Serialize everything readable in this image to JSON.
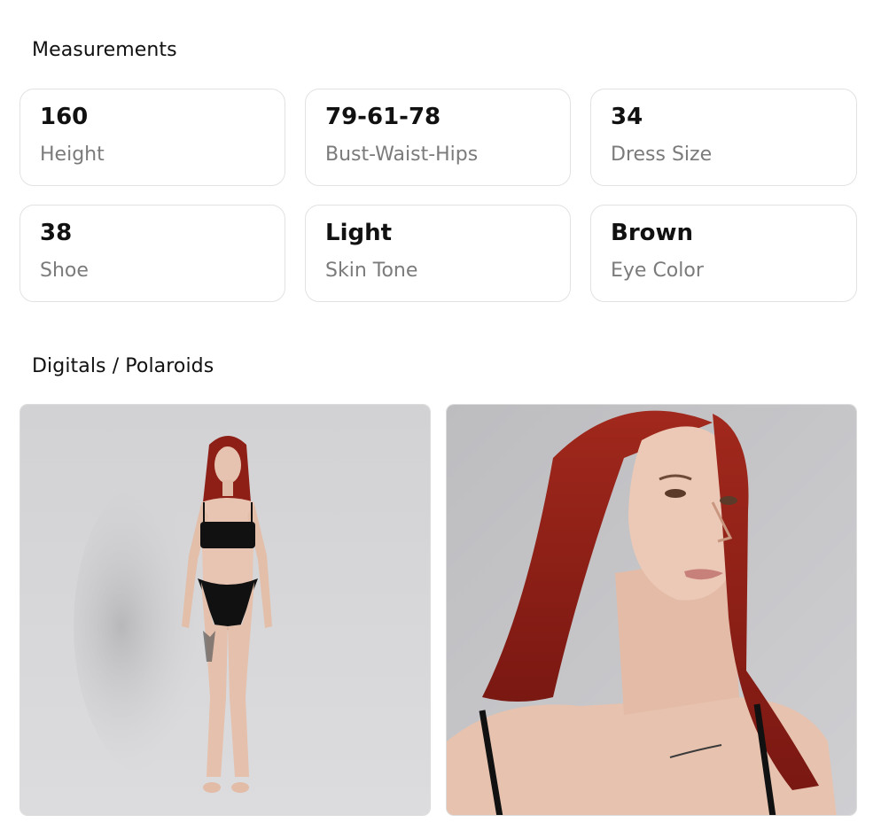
{
  "measurements": {
    "title": "Measurements",
    "items": [
      {
        "value": "160",
        "label": "Height"
      },
      {
        "value": "79-61-78",
        "label": "Bust-Waist-Hips"
      },
      {
        "value": "34",
        "label": "Dress Size"
      },
      {
        "value": "38",
        "label": "Shoe"
      },
      {
        "value": "Light",
        "label": "Skin Tone"
      },
      {
        "value": "Brown",
        "label": "Eye Color"
      }
    ]
  },
  "digitals": {
    "title": "Digitals / Polaroids",
    "photos": [
      {
        "alt": "full-body"
      },
      {
        "alt": "portrait"
      }
    ]
  },
  "colors": {
    "text": "#111111",
    "muted": "#7b7b7b",
    "card_border": "#e2e2e2",
    "backdrop": "#cfcfd1",
    "hair": "#8e1f17",
    "skin": "#e9c7b4",
    "garment": "#111111"
  }
}
